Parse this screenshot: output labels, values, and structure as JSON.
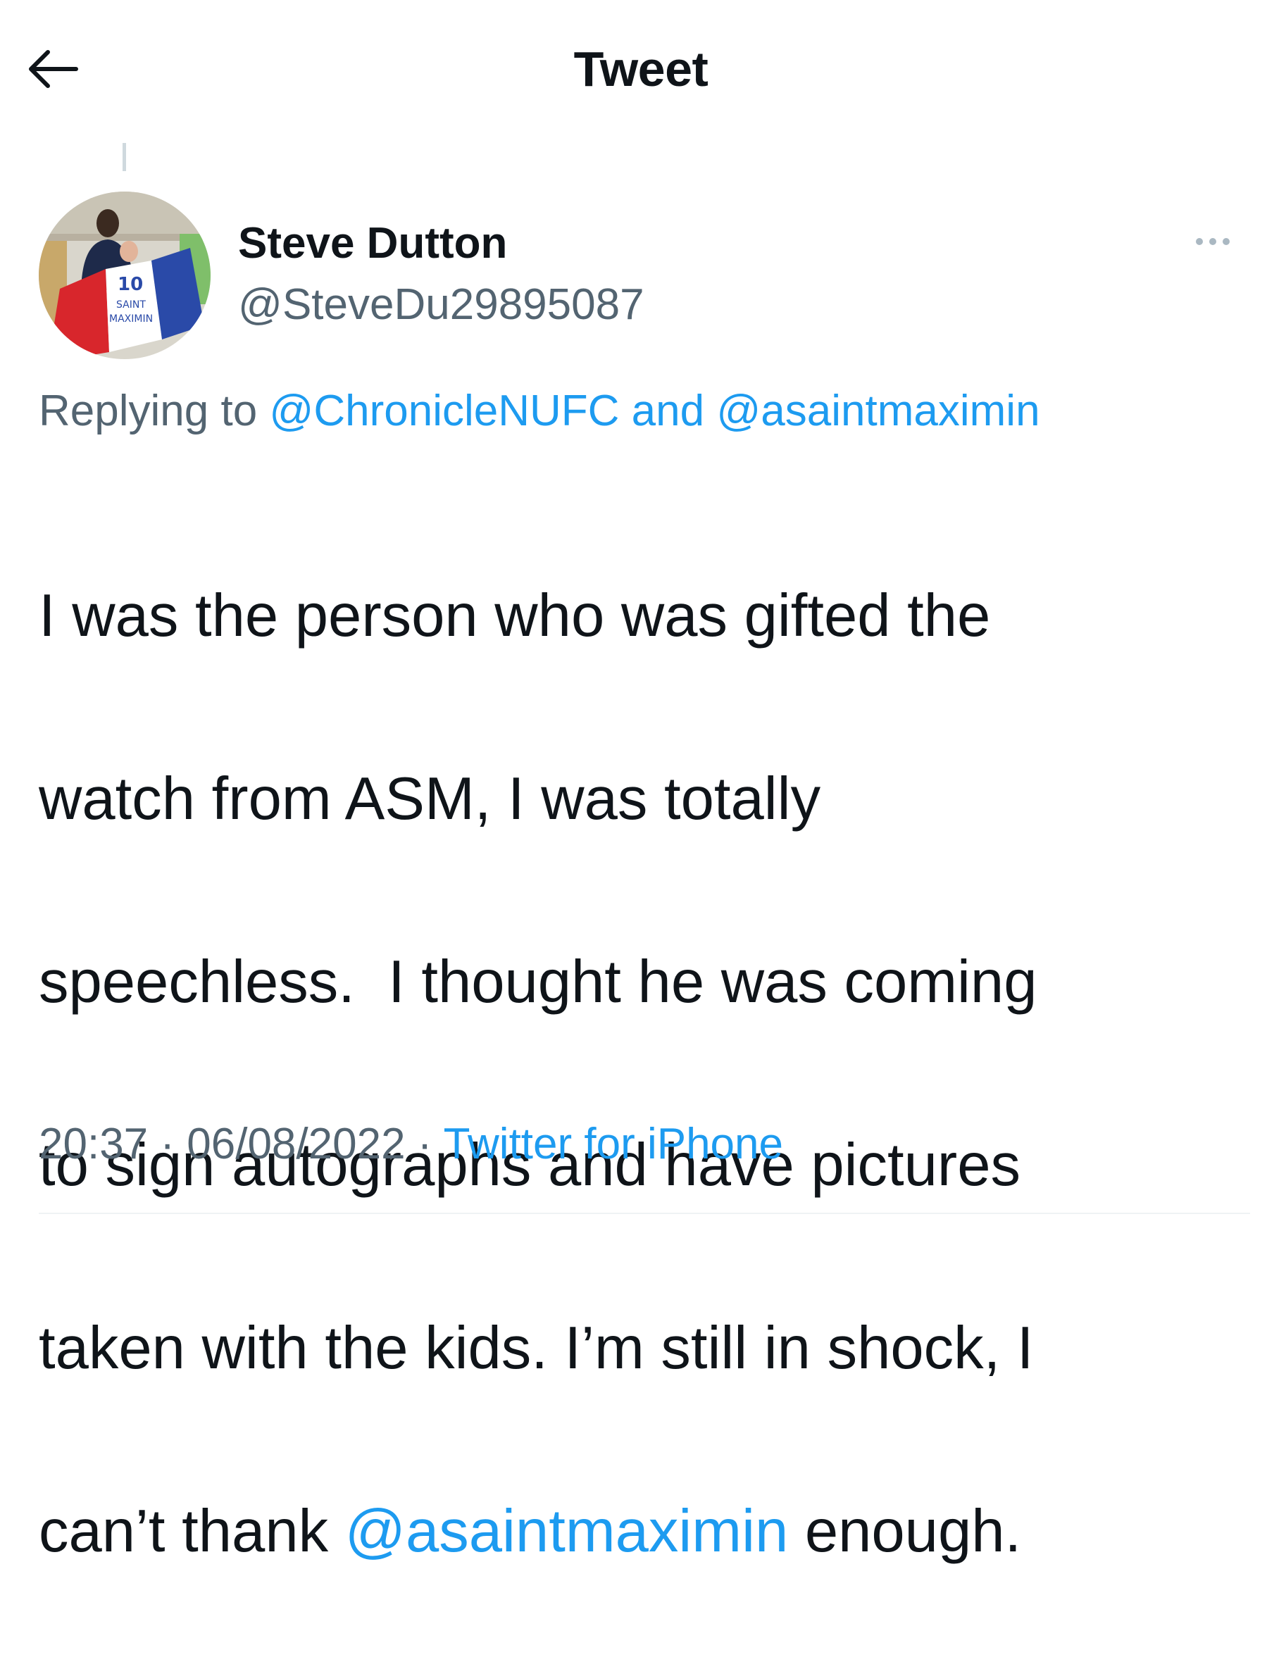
{
  "header": {
    "title": "Tweet",
    "back_icon": "arrow-left-icon"
  },
  "author": {
    "display_name": "Steve Dutton",
    "handle": "@SteveDu29895087",
    "avatar_icon": "profile-photo",
    "avatar_flag_text": "10 SAINT MAXIMIN"
  },
  "reply_context": {
    "prefix": "Replying to ",
    "mention_1": "@ChronicleNUFC",
    "joiner": " and ",
    "mention_2": "@asaintmaximin"
  },
  "tweet": {
    "lines": [
      "I was the person who was gifted the",
      "watch from ASM, I was totally",
      "speechless.  I thought he was coming",
      "to sign autographs and have pictures",
      "taken with the kids. I’m still in shock, I"
    ],
    "last_line_prefix": "can’t thank ",
    "last_line_mention": "@asaintmaximin",
    "last_line_suffix": " enough."
  },
  "meta": {
    "time": "20:37",
    "separator_1": " · ",
    "date": "06/08/2022",
    "separator_2": " · ",
    "source": "Twitter for iPhone"
  },
  "colors": {
    "link": "#1d9bf0",
    "secondary_text": "#536471",
    "primary_text": "#0f1419"
  }
}
